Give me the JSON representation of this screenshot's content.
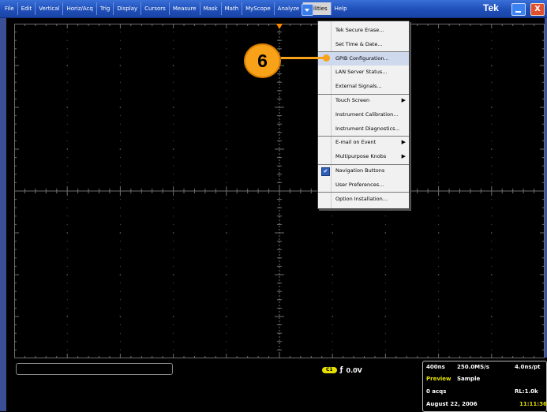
{
  "menubar": {
    "items": [
      "File",
      "Edit",
      "Vertical",
      "Horiz/Acq",
      "Trig",
      "Display",
      "Cursors",
      "Measure",
      "Mask",
      "Math",
      "MyScope",
      "Analyze",
      "Utilities",
      "Help"
    ],
    "active_index": 12,
    "brand": "Tek",
    "close_glyph": "X"
  },
  "utilities_menu": {
    "items": [
      {
        "label": "Tek Secure Erase...",
        "submenu": false
      },
      {
        "label": "Set Time & Date...",
        "submenu": false
      },
      {
        "label": "GPIB Configuration...",
        "submenu": false,
        "highlighted": true
      },
      {
        "label": "LAN Server Status...",
        "submenu": false
      },
      {
        "label": "External Signals...",
        "submenu": false
      },
      {
        "label": "Touch Screen",
        "submenu": true
      },
      {
        "label": "Instrument Calibration...",
        "submenu": false
      },
      {
        "label": "Instrument Diagnostics...",
        "submenu": false
      },
      {
        "label": "E-mail on Event",
        "submenu": true
      },
      {
        "label": "Multipurpose Knobs",
        "submenu": true
      },
      {
        "label": "Navigation Buttons",
        "submenu": false,
        "checked": true
      },
      {
        "label": "User Preferences...",
        "submenu": false
      },
      {
        "label": "Option Installation...",
        "submenu": false
      }
    ],
    "submenu_glyph": "▶",
    "check_glyph": "✔"
  },
  "callout": {
    "number": "6",
    "color": "#f8a21a"
  },
  "readout": {
    "ch_label": "C1",
    "trig_glyph": "ƒ",
    "trig_level": "0.0V"
  },
  "acq": {
    "time_div": "400ns",
    "sample_rate": "250.0MS/s",
    "time_per_pt": "4.0ns/pt",
    "mode": "Preview",
    "mode_color": "#e8e000",
    "acq_type": "Sample",
    "acqs": "0 acqs",
    "record_length": "RL:1.0k",
    "date": "August 22, 2006",
    "time": "11:11:36",
    "time_color": "#e8e000"
  },
  "colors": {
    "menubar": "#1f4fb8",
    "grid": "#6e6e6e",
    "trigger_marker": "#ff8800"
  }
}
